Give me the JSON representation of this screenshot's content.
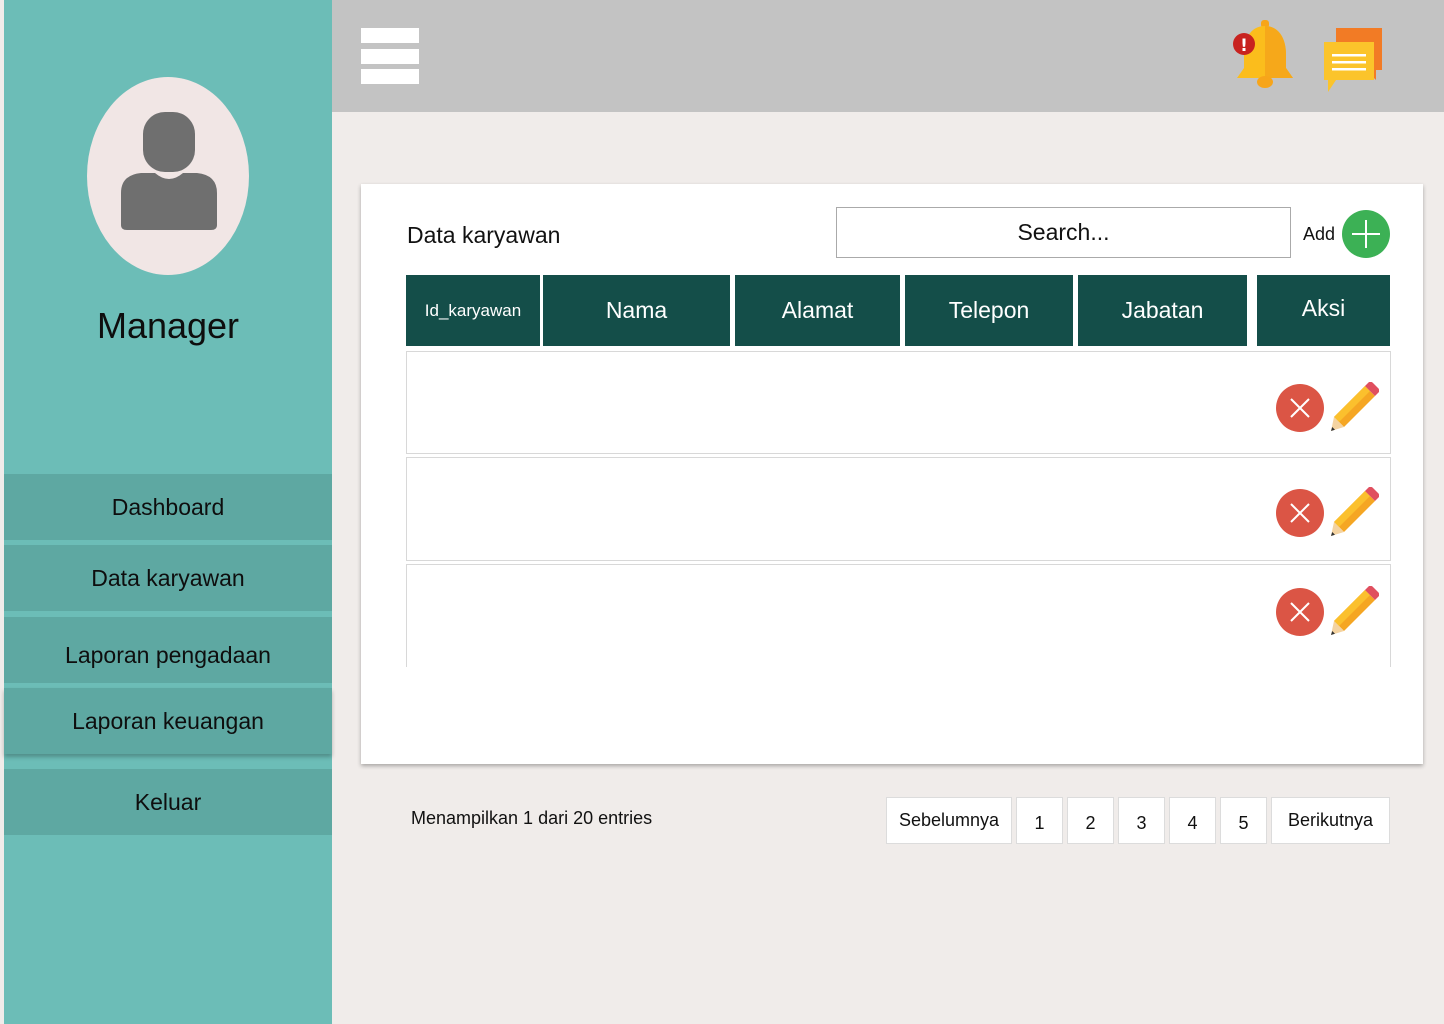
{
  "sidebar": {
    "role": "Manager",
    "items": [
      {
        "label": "Dashboard"
      },
      {
        "label": "Data karyawan"
      },
      {
        "label": "Laporan pengadaan"
      },
      {
        "label": "Laporan keuangan"
      },
      {
        "label": "Keluar"
      }
    ]
  },
  "header": {
    "menu_icon": "hamburger-menu-icon",
    "notification_icon": "bell-icon",
    "message_icon": "chat-icon",
    "notification_badge": "!"
  },
  "card": {
    "title": "Data karyawan",
    "search_placeholder": "Search...",
    "add_label": "Add",
    "columns": [
      "Id_karyawan",
      "Nama",
      "Alamat",
      "Telepon",
      "Jabatan",
      "Aksi"
    ]
  },
  "pagination": {
    "info": "Menampilkan 1 dari 20 entries",
    "prev": "Sebelumnya",
    "pages": [
      "1",
      "2",
      "3",
      "4",
      "5"
    ],
    "next": "Berikutnya"
  },
  "colors": {
    "sidebar": "#6cbdb7",
    "sidebar_item": "#5ea8a2",
    "header": "#c3c3c3",
    "table_header": "#144e49",
    "add": "#3cb155",
    "delete": "#db5545"
  }
}
